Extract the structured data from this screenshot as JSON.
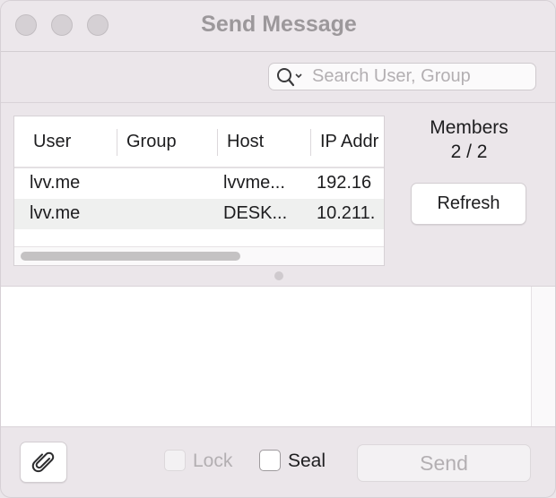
{
  "window": {
    "title": "Send Message"
  },
  "search": {
    "placeholder": "Search User, Group",
    "value": ""
  },
  "table": {
    "columns": [
      "User",
      "Group",
      "Host",
      "IP Addr"
    ],
    "rows": [
      {
        "user": "lvv.me",
        "group": "",
        "host": "lvvme...",
        "ip": "192.16"
      },
      {
        "user": "lvv.me",
        "group": "",
        "host": "DESK...",
        "ip": "10.211."
      }
    ]
  },
  "members": {
    "label": "Members",
    "count": "2 / 2",
    "refresh_label": "Refresh"
  },
  "message": {
    "value": ""
  },
  "bottom": {
    "lock_label": "Lock",
    "lock_checked": false,
    "lock_enabled": false,
    "seal_label": "Seal",
    "seal_checked": false,
    "send_label": "Send",
    "send_enabled": false
  },
  "icons": {
    "search": "search-icon",
    "attach": "paperclip-icon"
  }
}
